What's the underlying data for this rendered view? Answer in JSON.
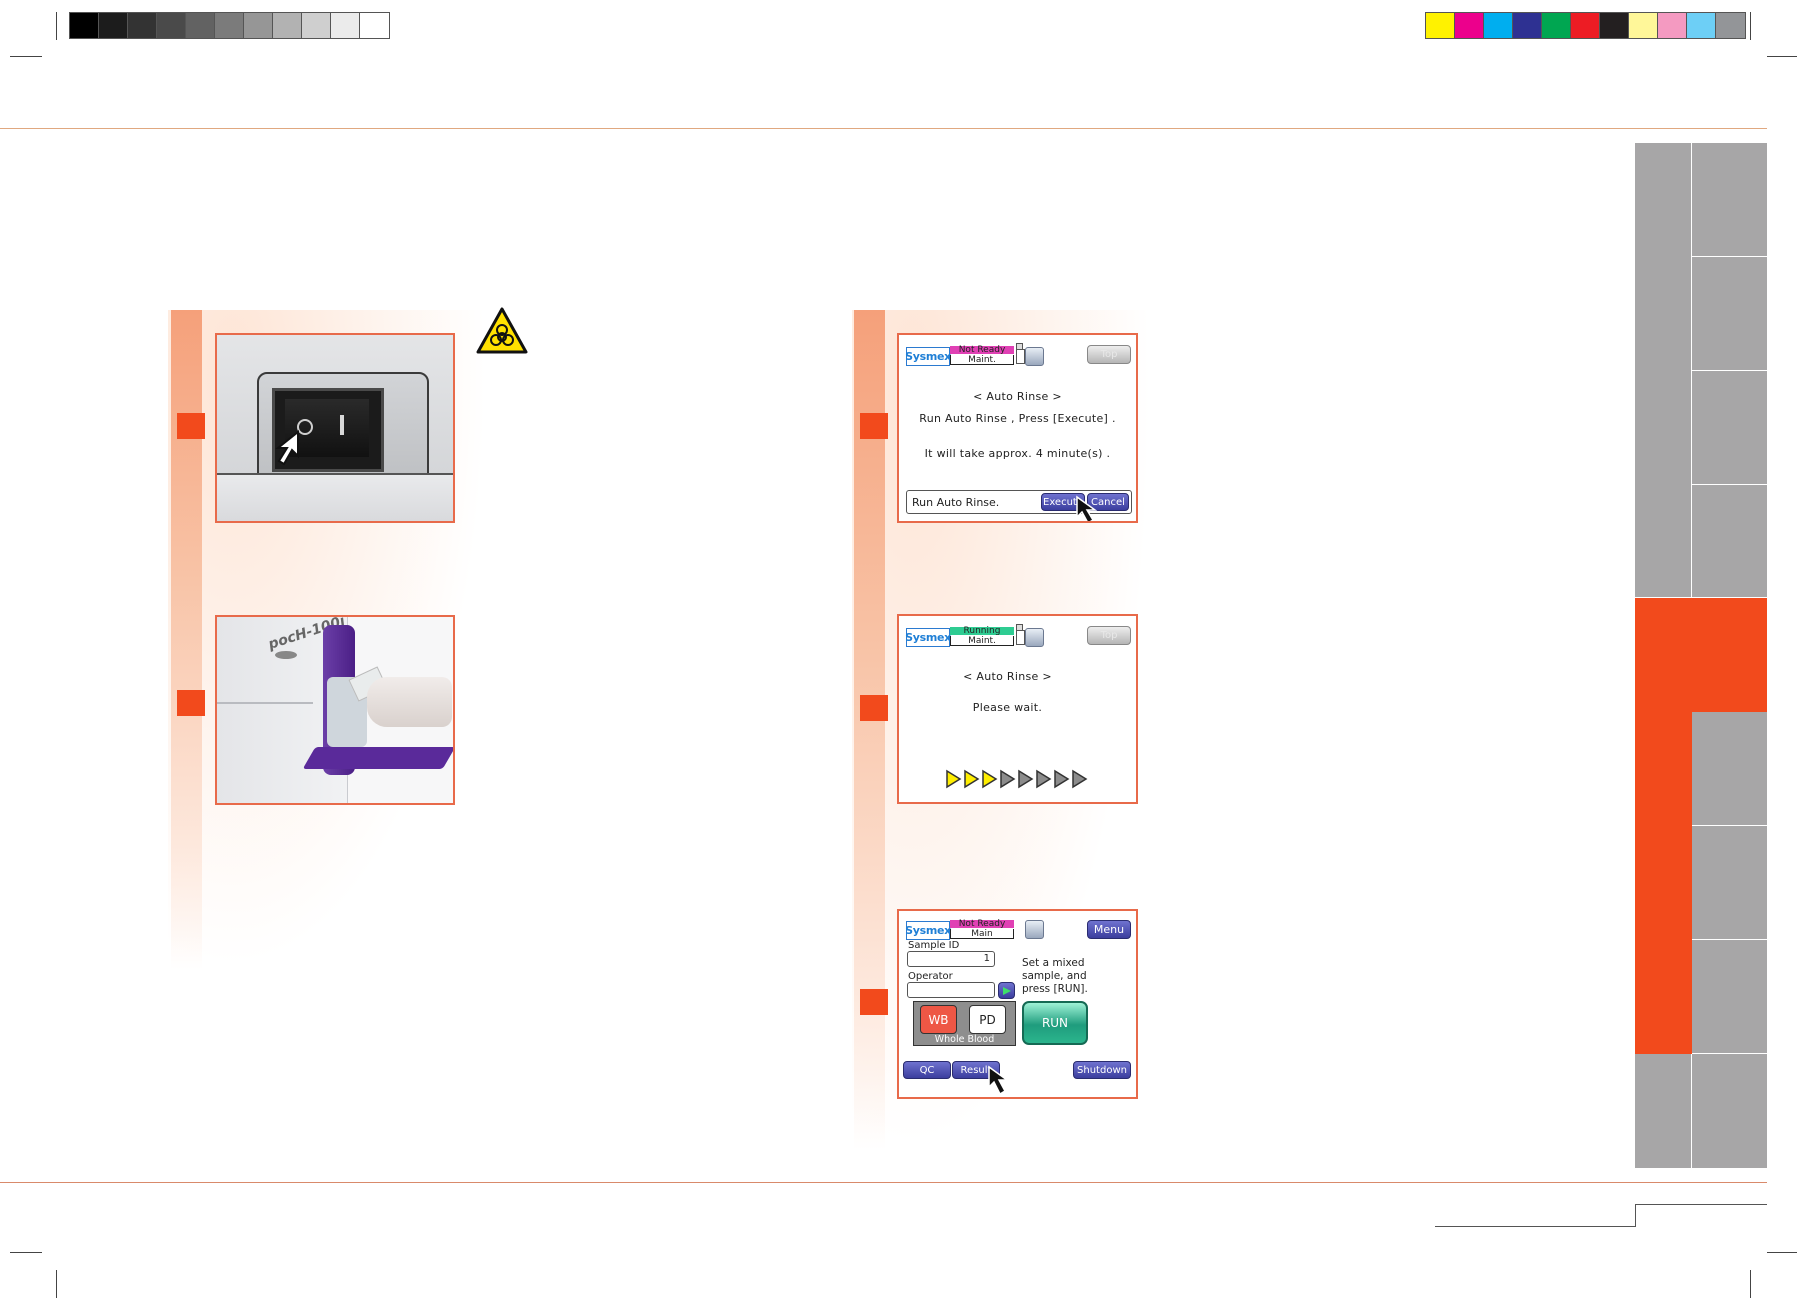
{
  "colors": {
    "accent": "#f24a1c",
    "frame": "#e86a4a",
    "tab_gray": "#a7a6a7",
    "tab_active": "#f24a1c",
    "status_not_ready": "#e040b4",
    "status_running": "#2ecc92",
    "progress_active": "#ffee00",
    "progress_idle": "#8c8c8c"
  },
  "print_marks": {
    "grayscale": [
      "#000000",
      "#1c1c1c",
      "#333333",
      "#4a4a4a",
      "#626262",
      "#7b7b7b",
      "#969696",
      "#b2b2b2",
      "#cfcfcf",
      "#ebebeb",
      "#ffffff"
    ],
    "color_bar": [
      "#fff200",
      "#ec008c",
      "#00aeef",
      "#2e3192",
      "#00a651",
      "#ed1c24",
      "#231f20",
      "#fff799",
      "#f49ac1",
      "#6dcff6",
      "#939598"
    ]
  },
  "left_panel": {
    "warning_icon": "biohazard-icon",
    "photo1": "power-switch-photo",
    "photo2": "analyzer-cleaning-photo",
    "device_model_label": "pocH-100i"
  },
  "screen1": {
    "logo": "Sysmex",
    "status": "Not Ready",
    "mode": "Maint.",
    "top_button": "Top",
    "title": "<   Auto Rinse   >",
    "line1": "Run  Auto  Rinse  ,  Press  [Execute]  .",
    "line2": "It  will  take  approx.  4    minute(s)  .",
    "message": "Run  Auto  Rinse.",
    "execute_button": "Execute",
    "cancel_button": "Cancel"
  },
  "screen2": {
    "logo": "Sysmex",
    "status": "Running",
    "mode": "Maint.",
    "top_button": "Top",
    "title": "<    Auto Rinse    >",
    "line1": "Please  wait.",
    "progress": {
      "done": 3,
      "total": 8
    }
  },
  "screen3": {
    "logo": "Sysmex",
    "status": "Not Ready",
    "mode": "Main",
    "menu_button": "Menu",
    "sample_id_label": "Sample ID",
    "sample_id_value": "1",
    "operator_label": "Operator",
    "operator_value": "",
    "instruction_1": "Set a mixed",
    "instruction_2": "sample, and",
    "instruction_3": "press [RUN].",
    "wb_button": "WB",
    "pd_button": "PD",
    "sample_mode": "Whole Blood",
    "run_button": "RUN",
    "qc_button": "QC",
    "result_button": "Result",
    "shutdown_button": "Shutdown"
  }
}
